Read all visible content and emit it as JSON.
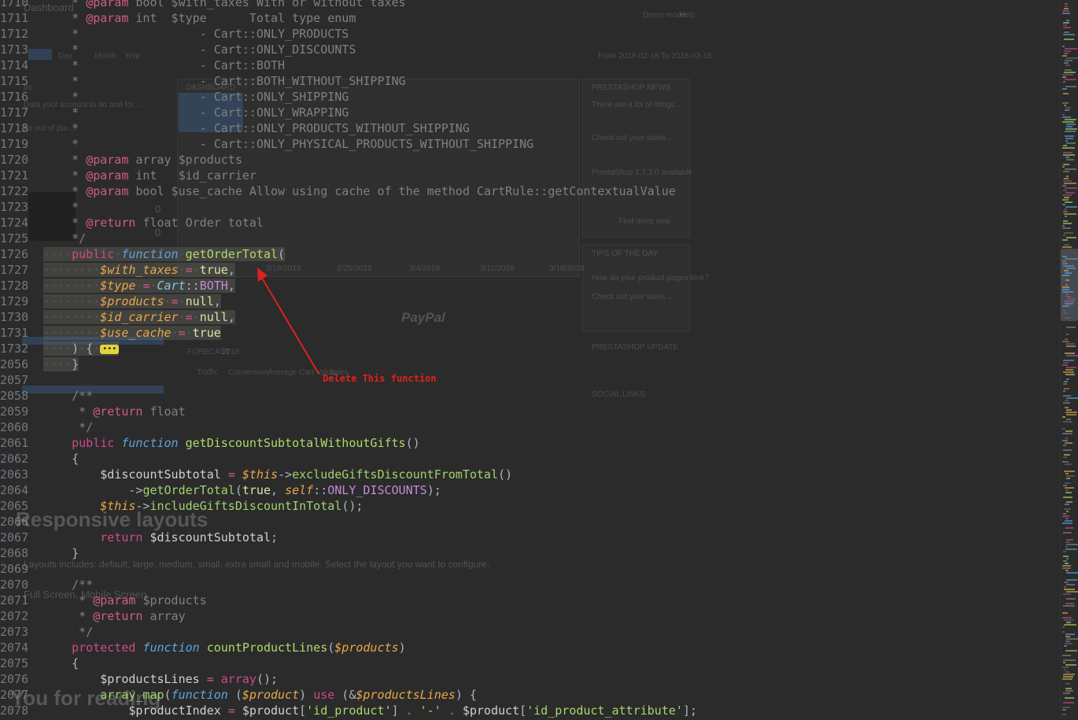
{
  "background_ghost": {
    "title": "Dashboard",
    "top_right": [
      "Demo mode",
      "Help"
    ],
    "tabs": [
      "Day",
      "Month",
      "Year"
    ],
    "date_range": "From 2018-02-18 To 2018-03-18",
    "left_texts": [
      "bs",
      "Data your account to do and for ...",
      "for out of pla ..."
    ],
    "dashboard_label": "DASHBOARD",
    "news_label": "PRESTASHOP NEWS",
    "news_lines": [
      "There are a lot of things ...",
      "Check out your sales ...",
      "PrestaShop 1.7.3.0 available",
      "Find more now"
    ],
    "tips_label": "TIPS OF THE DAY",
    "tips_lines": [
      "How do your product pages look?",
      "Check out your sales ..."
    ],
    "updates_label": "PRESTASHOP UPDATE",
    "paypal": "PayPal",
    "forecast_label": "FORECAST",
    "forecast_year": "2018",
    "legend": [
      "Traffic",
      "Conversion",
      "Average Cart Value",
      "Sales"
    ],
    "social_label": "SOCIAL LINKS",
    "dates": [
      "2/18/2018",
      "2/25/2018",
      "3/4/2018",
      "3/11/2018",
      "3/18/2018"
    ],
    "zero_values": [
      "0",
      "0"
    ],
    "responsive_heading": "Responsive layouts",
    "responsive_text": "Layouts includes: default, large, medium, small, extra small and mobile. Select the layout you want to configure.",
    "screen_text": "Full Screen, Mobile Screen",
    "thanks_heading": "You for reading"
  },
  "annotation": {
    "label": "Delete This function",
    "color": "#e02020"
  },
  "colors": {
    "background": "#2b2b2b",
    "keyword": "#cc4a8a",
    "function_keyword": "#5ea5e0",
    "function_name": "#b2d86a",
    "variable": "#e9a84a",
    "comment": "#808080"
  },
  "code_lines": [
    {
      "n": "1710",
      "html": "    <span class=\"doc\">* </span><span class=\"tag\">@param</span><span class=\"doc\"> bool $with_taxes With or without taxes</span>"
    },
    {
      "n": "1711",
      "html": "    <span class=\"doc\">* </span><span class=\"tag\">@param</span><span class=\"doc\"> int  $type      Total type enum</span>"
    },
    {
      "n": "1712",
      "html": "    <span class=\"doc\">*                 - Cart::ONLY_PRODUCTS</span>"
    },
    {
      "n": "1713",
      "html": "    <span class=\"doc\">*                 - Cart::ONLY_DISCOUNTS</span>"
    },
    {
      "n": "1714",
      "html": "    <span class=\"doc\">*                 - Cart::BOTH</span>"
    },
    {
      "n": "1715",
      "html": "    <span class=\"doc\">*                 - Cart::BOTH_WITHOUT_SHIPPING</span>"
    },
    {
      "n": "1716",
      "html": "    <span class=\"doc\">*                 - Cart::ONLY_SHIPPING</span>"
    },
    {
      "n": "1717",
      "html": "    <span class=\"doc\">*                 - Cart::ONLY_WRAPPING</span>"
    },
    {
      "n": "1718",
      "html": "    <span class=\"doc\">*                 - Cart::ONLY_PRODUCTS_WITHOUT_SHIPPING</span>"
    },
    {
      "n": "1719",
      "html": "    <span class=\"doc\">*                 - Cart::ONLY_PHYSICAL_PRODUCTS_WITHOUT_SHIPPING</span>"
    },
    {
      "n": "1720",
      "html": "    <span class=\"doc\">* </span><span class=\"tag\">@param</span><span class=\"doc\"> array $products</span>"
    },
    {
      "n": "1721",
      "html": "    <span class=\"doc\">* </span><span class=\"tag\">@param</span><span class=\"doc\"> int   $id_carrier</span>"
    },
    {
      "n": "1722",
      "html": "    <span class=\"doc\">* </span><span class=\"tag\">@param</span><span class=\"doc\"> bool $use_cache Allow using cache of the method CartRule::getContextualValue</span>"
    },
    {
      "n": "1723",
      "html": "    <span class=\"doc\">*</span>"
    },
    {
      "n": "1724",
      "html": "    <span class=\"doc\">* </span><span class=\"tag\">@return</span><span class=\"doc\"> float Order total</span>"
    },
    {
      "n": "1725",
      "html": "    <span class=\"doc\">*/</span>"
    },
    {
      "n": "1726",
      "html": "<span class=\"hl\"><span class=\"ws\">····</span><span class=\"kw\">public</span><span class=\"ws\">·</span><span class=\"fn-kw\">function</span><span class=\"ws\">·</span><span class=\"fname\">getOrderTotal</span>(</span>"
    },
    {
      "n": "1727",
      "html": "<span class=\"hl\"><span class=\"ws\">········</span><span class=\"var\">$with_taxes</span><span class=\"ws\">·</span><span class=\"op\">=</span><span class=\"ws\">·</span><span class=\"bool\">true</span>,</span>"
    },
    {
      "n": "1728",
      "html": "<span class=\"hl\"><span class=\"ws\">········</span><span class=\"var\">$type</span><span class=\"ws\">·</span><span class=\"op\">=</span><span class=\"ws\">·</span><span class=\"cls\">Cart</span>::<span class=\"const\">BOTH</span>,</span>"
    },
    {
      "n": "1729",
      "html": "<span class=\"hl\"><span class=\"ws\">········</span><span class=\"var\">$products</span><span class=\"ws\">·</span><span class=\"op\">=</span><span class=\"ws\">·</span><span class=\"bool\">null</span>,</span>"
    },
    {
      "n": "1730",
      "html": "<span class=\"hl\"><span class=\"ws\">········</span><span class=\"var\">$id_carrier</span><span class=\"ws\">·</span><span class=\"op\">=</span><span class=\"ws\">·</span><span class=\"bool\">null</span>,</span>"
    },
    {
      "n": "1731",
      "html": "<span class=\"hl\"><span class=\"ws\">········</span><span class=\"var\">$use_cache</span><span class=\"ws\">·</span><span class=\"op\">=</span><span class=\"ws\">·</span><span class=\"bool\">true</span></span>"
    },
    {
      "n": "1732",
      "html": "<span class=\"hl\"><span class=\"ws\">····</span>)<span class=\"ws\">·</span>{<span class=\"ws\">·</span><span class=\"fold\">•••</span></span>"
    },
    {
      "n": "2056",
      "html": "<span class=\"hl\"><span class=\"ws\">····</span>}</span>"
    },
    {
      "n": "2057",
      "html": ""
    },
    {
      "n": "2058",
      "html": "    <span class=\"doc\">/**</span>"
    },
    {
      "n": "2059",
      "html": "     <span class=\"doc\">* </span><span class=\"tag\">@return</span><span class=\"doc\"> float</span>"
    },
    {
      "n": "2060",
      "html": "     <span class=\"doc\">*/</span>"
    },
    {
      "n": "2061",
      "html": "    <span class=\"kw\">public</span> <span class=\"fn-kw\">function</span> <span class=\"fname\">getDiscountSubtotalWithoutGifts</span>()"
    },
    {
      "n": "2062",
      "html": "    {"
    },
    {
      "n": "2063",
      "html": "        <span class=\"plainvar\">$discountSubtotal</span> <span class=\"op\">=</span> <span class=\"var\">$this</span>-><span class=\"method\">excludeGiftsDiscountFromTotal</span>()"
    },
    {
      "n": "2064",
      "html": "            -><span class=\"method\">getOrderTotal</span>(<span class=\"bool\">true</span>, <span class=\"var\">self</span>::<span class=\"const\">ONLY_DISCOUNTS</span>);"
    },
    {
      "n": "2065",
      "html": "        <span class=\"var\">$this</span>-><span class=\"method\">includeGiftsDiscountInTotal</span>();"
    },
    {
      "n": "2066",
      "html": ""
    },
    {
      "n": "2067",
      "html": "        <span class=\"kw\">return</span> <span class=\"plainvar\">$discountSubtotal</span>;"
    },
    {
      "n": "2068",
      "html": "    }"
    },
    {
      "n": "2069",
      "html": ""
    },
    {
      "n": "2070",
      "html": "    <span class=\"doc\">/**</span>"
    },
    {
      "n": "2071",
      "html": "     <span class=\"doc\">* </span><span class=\"tag\">@param</span><span class=\"doc\"> $products</span>"
    },
    {
      "n": "2072",
      "html": "     <span class=\"doc\">* </span><span class=\"tag\">@return</span><span class=\"doc\"> array</span>"
    },
    {
      "n": "2073",
      "html": "     <span class=\"doc\">*/</span>"
    },
    {
      "n": "2074",
      "html": "    <span class=\"kw\">protected</span> <span class=\"fn-kw\">function</span> <span class=\"fname\">countProductLines</span>(<span class=\"var\">$products</span>)"
    },
    {
      "n": "2075",
      "html": "    {"
    },
    {
      "n": "2076",
      "html": "        <span class=\"plainvar\">$productsLines</span> <span class=\"op\">=</span> <span class=\"kw\">array</span>();"
    },
    {
      "n": "2077",
      "html": "        <span class=\"method\">array_map</span>(<span class=\"fn-kw\">function</span> (<span class=\"var\">$product</span>) <span class=\"kw\">use</span> (&amp;<span class=\"var\">$productsLines</span>) {"
    },
    {
      "n": "2078",
      "html": "            <span class=\"plainvar\">$productIndex</span> <span class=\"op\">=</span> <span class=\"plainvar\">$product</span>[<span class=\"str\">'id_product'</span>] <span class=\"op\">.</span> <span class=\"str\">'-'</span> <span class=\"op\">.</span> <span class=\"plainvar\">$product</span>[<span class=\"str\">'id_product_attribute'</span>];"
    }
  ]
}
